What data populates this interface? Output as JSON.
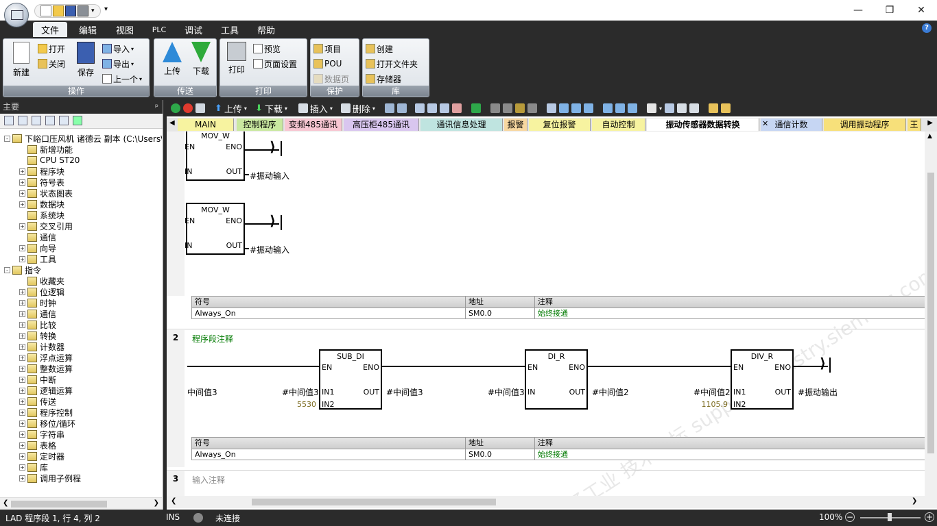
{
  "ribbon_tabs": [
    "文件",
    "编辑",
    "视图",
    "PLC",
    "调试",
    "工具",
    "帮助"
  ],
  "ribbon": {
    "ops": {
      "title": "操作",
      "new": "新建",
      "open": "打开",
      "close": "关闭",
      "save": "保存",
      "import": "导入",
      "export": "导出",
      "prev": "上一个"
    },
    "transfer": {
      "title": "传送",
      "upload": "上传",
      "download": "下载"
    },
    "print": {
      "title": "打印",
      "print": "打印",
      "preview": "预览",
      "page_setup": "页面设置"
    },
    "protect": {
      "title": "保护",
      "project": "项目",
      "pou": "POU",
      "datablock": "数据页"
    },
    "lib": {
      "title": "库",
      "create": "创建",
      "open_folder": "打开文件夹",
      "memory": "存储器"
    }
  },
  "left_panel": {
    "title": "主要",
    "tree": [
      {
        "label": "下峪口压风机 诸德云 副本 (C:\\Users\\",
        "level": 0,
        "exp": "-"
      },
      {
        "label": "新增功能",
        "level": 1,
        "exp": ""
      },
      {
        "label": "CPU ST20",
        "level": 1,
        "exp": ""
      },
      {
        "label": "程序块",
        "level": 1,
        "exp": "+"
      },
      {
        "label": "符号表",
        "level": 1,
        "exp": "+"
      },
      {
        "label": "状态图表",
        "level": 1,
        "exp": "+"
      },
      {
        "label": "数据块",
        "level": 1,
        "exp": "+"
      },
      {
        "label": "系统块",
        "level": 1,
        "exp": ""
      },
      {
        "label": "交叉引用",
        "level": 1,
        "exp": "+"
      },
      {
        "label": "通信",
        "level": 1,
        "exp": ""
      },
      {
        "label": "向导",
        "level": 1,
        "exp": "+"
      },
      {
        "label": "工具",
        "level": 1,
        "exp": "+"
      },
      {
        "label": "指令",
        "level": 0,
        "exp": "-"
      },
      {
        "label": "收藏夹",
        "level": 1,
        "exp": ""
      },
      {
        "label": "位逻辑",
        "level": 1,
        "exp": "+"
      },
      {
        "label": "时钟",
        "level": 1,
        "exp": "+"
      },
      {
        "label": "通信",
        "level": 1,
        "exp": "+"
      },
      {
        "label": "比较",
        "level": 1,
        "exp": "+"
      },
      {
        "label": "转换",
        "level": 1,
        "exp": "+"
      },
      {
        "label": "计数器",
        "level": 1,
        "exp": "+"
      },
      {
        "label": "浮点运算",
        "level": 1,
        "exp": "+"
      },
      {
        "label": "整数运算",
        "level": 1,
        "exp": "+"
      },
      {
        "label": "中断",
        "level": 1,
        "exp": "+"
      },
      {
        "label": "逻辑运算",
        "level": 1,
        "exp": "+"
      },
      {
        "label": "传送",
        "level": 1,
        "exp": "+"
      },
      {
        "label": "程序控制",
        "level": 1,
        "exp": "+"
      },
      {
        "label": "移位/循环",
        "level": 1,
        "exp": "+"
      },
      {
        "label": "字符串",
        "level": 1,
        "exp": "+"
      },
      {
        "label": "表格",
        "level": 1,
        "exp": "+"
      },
      {
        "label": "定时器",
        "level": 1,
        "exp": "+"
      },
      {
        "label": "库",
        "level": 1,
        "exp": "+"
      },
      {
        "label": "调用子例程",
        "level": 1,
        "exp": "+"
      }
    ]
  },
  "toolbar": {
    "upload": "上传",
    "download": "下载",
    "insert": "插入",
    "delete": "删除"
  },
  "program_tabs": [
    {
      "label": "MAIN",
      "color": "#f7f3a0"
    },
    {
      "label": "控制程序",
      "color": "#c9e8a0"
    },
    {
      "label": "变频485通讯",
      "color": "#f7c6d2"
    },
    {
      "label": "高压柜485通讯",
      "color": "#d9c6ef"
    },
    {
      "label": "通讯信息处理",
      "color": "#bfe4e0"
    },
    {
      "label": "报警",
      "color": "#f7d7a0"
    },
    {
      "label": "复位报警",
      "color": "#f7f3a0"
    },
    {
      "label": "自动控制",
      "color": "#f7f3a0"
    },
    {
      "label": "振动传感器数据转换",
      "color": "#f0f0f0"
    },
    {
      "label": "通信计数",
      "color": "#c6d6f3"
    },
    {
      "label": "调用振动程序",
      "color": "#f7e07a"
    },
    {
      "label": "王",
      "color": "#f7e07a"
    }
  ],
  "ladder": {
    "mov1": {
      "title": "MOV_W",
      "en": "EN",
      "eno": "ENO",
      "in": "IN",
      "out": "OUT",
      "out_label": "#振动输入"
    },
    "mov2": {
      "title": "MOV_W",
      "en": "EN",
      "eno": "ENO",
      "in": "IN",
      "out": "OUT",
      "out_label": "#振动输入"
    },
    "symtab1": {
      "h_sym": "符号",
      "h_addr": "地址",
      "h_cmt": "注释",
      "sym": "Always_On",
      "addr": "SM0.0",
      "cmt": "始终接通"
    },
    "net2": {
      "num": "2",
      "comment": "程序段注释"
    },
    "sub_di": {
      "title": "SUB_DI",
      "en": "EN",
      "eno": "ENO",
      "in1": "IN1",
      "in2": "IN2",
      "out": "OUT",
      "in1_label": "#中间值3",
      "in2_const": "5530",
      "out_label": "#中间值3"
    },
    "left_label": "中间值3",
    "di_r": {
      "title": "DI_R",
      "en": "EN",
      "eno": "ENO",
      "in": "IN",
      "out": "OUT",
      "in_label": "#中间值3",
      "out_label": "#中间值2"
    },
    "div_r": {
      "title": "DIV_R",
      "en": "EN",
      "eno": "ENO",
      "in1": "IN1",
      "in2": "IN2",
      "out": "OUT",
      "in1_label": "#中间值2",
      "in2_const": "1105.9",
      "out_label": "#振动输出"
    },
    "symtab2": {
      "h_sym": "符号",
      "h_addr": "地址",
      "h_cmt": "注释",
      "sym": "Always_On",
      "addr": "SM0.0",
      "cmt": "始终接通"
    },
    "net3": {
      "num": "3",
      "comment": "输入注释"
    },
    "watermark": "西门子工业  技术论坛  support.industry.siemens.com/cs"
  },
  "status": {
    "mode": "LAD 程序段 1, 行 4, 列 2",
    "ins": "INS",
    "conn": "未连接",
    "zoom": "100%"
  }
}
